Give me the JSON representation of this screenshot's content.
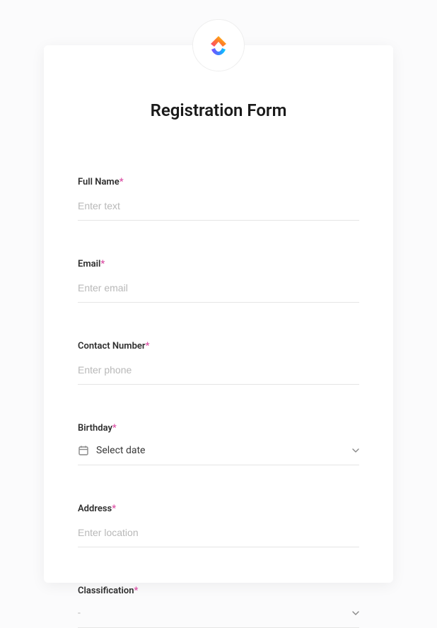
{
  "title": "Registration Form",
  "fields": {
    "full_name": {
      "label": "Full Name",
      "required": "*",
      "placeholder": "Enter text"
    },
    "email": {
      "label": "Email",
      "required": "*",
      "placeholder": "Enter email"
    },
    "contact_number": {
      "label": "Contact Number",
      "required": "*",
      "placeholder": "Enter phone"
    },
    "birthday": {
      "label": "Birthday",
      "required": "*",
      "placeholder": "Select date"
    },
    "address": {
      "label": "Address",
      "required": "*",
      "placeholder": "Enter location"
    },
    "classification": {
      "label": "Classification",
      "required": "*",
      "placeholder": "-"
    }
  }
}
